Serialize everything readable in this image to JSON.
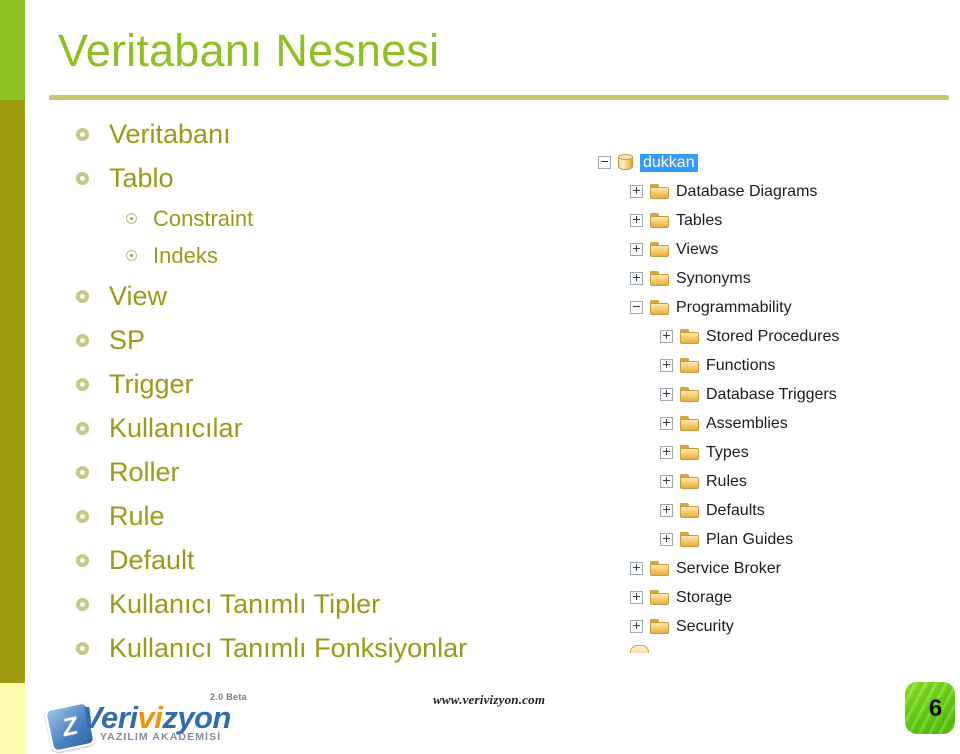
{
  "slide": {
    "title": "Veritabanı Nesnesi",
    "page_number": "6",
    "accent_green": "#8CC11F",
    "olive": "#9A9A16",
    "rule_color": "#C4C471"
  },
  "bullets": [
    {
      "level": 1,
      "label": "Veritabanı",
      "bullet": "ring-bullet-icon"
    },
    {
      "level": 1,
      "label": "Tablo",
      "bullet": "ring-bullet-icon"
    },
    {
      "level": 2,
      "label": "Constraint",
      "bullet": "dot-ring-bullet-icon"
    },
    {
      "level": 2,
      "label": "Indeks",
      "bullet": "dot-ring-bullet-icon"
    },
    {
      "level": 1,
      "label": "View",
      "bullet": "ring-bullet-icon"
    },
    {
      "level": 1,
      "label": "SP",
      "bullet": "ring-bullet-icon"
    },
    {
      "level": 1,
      "label": "Trigger",
      "bullet": "ring-bullet-icon"
    },
    {
      "level": 1,
      "label": "Kullanıcılar",
      "bullet": "ring-bullet-icon"
    },
    {
      "level": 1,
      "label": "Roller",
      "bullet": "ring-bullet-icon"
    },
    {
      "level": 1,
      "label": "Rule",
      "bullet": "ring-bullet-icon"
    },
    {
      "level": 1,
      "label": "Default",
      "bullet": "ring-bullet-icon"
    },
    {
      "level": 1,
      "label": "Kullanıcı Tanımlı Tipler",
      "bullet": "ring-bullet-icon"
    },
    {
      "level": 1,
      "label": "Kullanıcı Tanımlı Fonksiyonlar",
      "bullet": "ring-bullet-icon"
    }
  ],
  "tree": {
    "nodes": [
      {
        "depth": 0,
        "label": "dukkan",
        "icon": "database-icon",
        "expander": "minus",
        "selected": true
      },
      {
        "depth": 1,
        "label": "Database Diagrams",
        "icon": "folder-icon",
        "expander": "plus",
        "selected": false
      },
      {
        "depth": 1,
        "label": "Tables",
        "icon": "folder-icon",
        "expander": "plus",
        "selected": false
      },
      {
        "depth": 1,
        "label": "Views",
        "icon": "folder-icon",
        "expander": "plus",
        "selected": false
      },
      {
        "depth": 1,
        "label": "Synonyms",
        "icon": "folder-icon",
        "expander": "plus",
        "selected": false
      },
      {
        "depth": 1,
        "label": "Programmability",
        "icon": "folder-icon",
        "expander": "minus",
        "selected": false
      },
      {
        "depth": 2,
        "label": "Stored Procedures",
        "icon": "folder-icon",
        "expander": "plus",
        "selected": false
      },
      {
        "depth": 2,
        "label": "Functions",
        "icon": "folder-icon",
        "expander": "plus",
        "selected": false
      },
      {
        "depth": 2,
        "label": "Database Triggers",
        "icon": "folder-icon",
        "expander": "plus",
        "selected": false
      },
      {
        "depth": 2,
        "label": "Assemblies",
        "icon": "folder-icon",
        "expander": "plus",
        "selected": false
      },
      {
        "depth": 2,
        "label": "Types",
        "icon": "folder-icon",
        "expander": "plus",
        "selected": false
      },
      {
        "depth": 2,
        "label": "Rules",
        "icon": "folder-icon",
        "expander": "plus",
        "selected": false
      },
      {
        "depth": 2,
        "label": "Defaults",
        "icon": "folder-icon",
        "expander": "plus",
        "selected": false
      },
      {
        "depth": 2,
        "label": "Plan Guides",
        "icon": "folder-icon",
        "expander": "plus",
        "selected": false
      },
      {
        "depth": 1,
        "label": "Service Broker",
        "icon": "folder-icon",
        "expander": "plus",
        "selected": false
      },
      {
        "depth": 1,
        "label": "Storage",
        "icon": "folder-icon",
        "expander": "plus",
        "selected": false
      },
      {
        "depth": 1,
        "label": "Security",
        "icon": "folder-icon",
        "expander": "plus",
        "selected": false
      }
    ]
  },
  "footer": {
    "url": "www.verivizyon.com",
    "logo": {
      "tile_letter": "Z",
      "word_before": "Veri",
      "word_highlight": "vi",
      "word_after": "zyon",
      "subtitle": "YAZILIM AKADEMİSİ",
      "badge": "2.0 Beta"
    }
  }
}
